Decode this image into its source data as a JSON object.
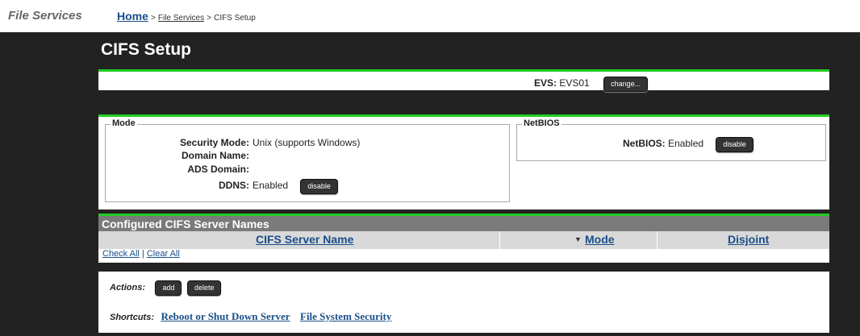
{
  "header": {
    "section_label": "File Services",
    "breadcrumb": {
      "home": "Home",
      "sep1": ">",
      "file_services": "File Services",
      "sep2": ">",
      "current": "CIFS Setup"
    }
  },
  "page": {
    "title": "CIFS Setup"
  },
  "evs": {
    "label": "EVS:",
    "value": "EVS01",
    "change_button": "change..."
  },
  "mode": {
    "legend": "Mode",
    "fields": [
      {
        "label": "Security Mode:",
        "value": "Unix (supports Windows)"
      },
      {
        "label": "Domain Name:",
        "value": ""
      },
      {
        "label": "ADS Domain:",
        "value": ""
      },
      {
        "label": "DDNS:",
        "value": "Enabled"
      }
    ],
    "ddns_button": "disable"
  },
  "netbios": {
    "legend": "NetBIOS",
    "label": "NetBIOS:",
    "value": "Enabled",
    "button": "disable"
  },
  "configured": {
    "title": "Configured CIFS Server Names",
    "columns": {
      "name": "CIFS Server Name",
      "mode": "Mode",
      "mode_sort_icon": "▼",
      "disjoint": "Disjoint"
    },
    "check_all": "Check All",
    "divider": "|",
    "clear_all": "Clear All"
  },
  "actions": {
    "label": "Actions:",
    "add": "add",
    "delete": "delete",
    "shortcuts_label": "Shortcuts:",
    "shortcut_reboot": "Reboot or Shut Down Server",
    "shortcut_security": "File System Security"
  },
  "colors": {
    "accent": "#22cc22",
    "background": "#222222",
    "link": "#1a4f8b",
    "header_gray": "#7a7a7a"
  }
}
